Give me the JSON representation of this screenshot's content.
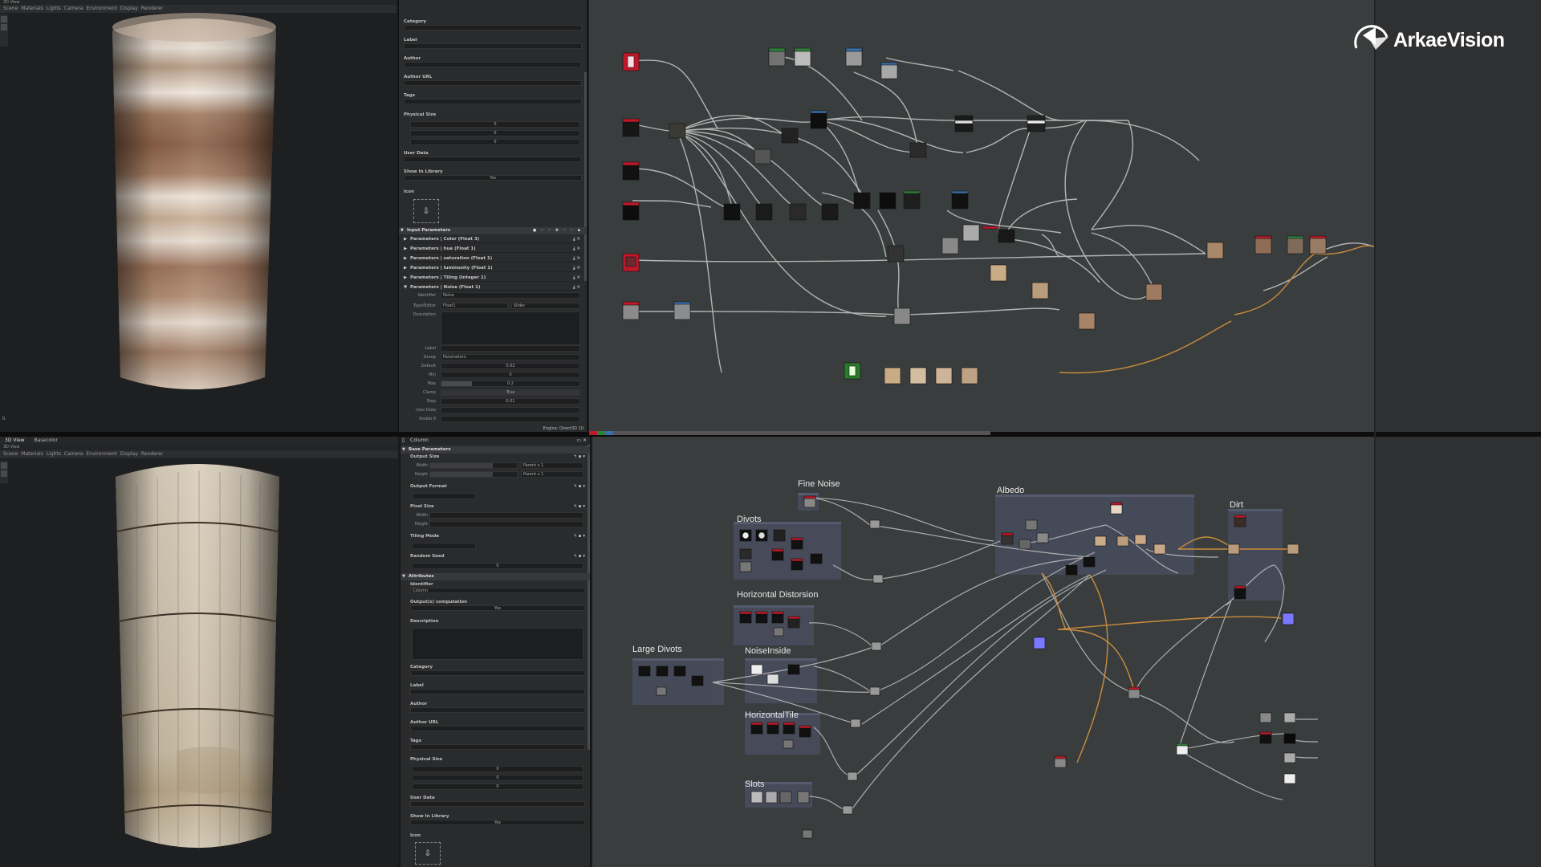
{
  "brand": {
    "name": "ArkaeVision"
  },
  "top_viewport": {
    "title": "3D View",
    "menu": [
      "Scene",
      "Materials",
      "Lights",
      "Camera",
      "Environment",
      "Display",
      "Renderer"
    ]
  },
  "bottom_viewport": {
    "tabs": [
      "3D View",
      "Basecolor"
    ],
    "title": "3D View",
    "menu": [
      "Scene",
      "Materials",
      "Lights",
      "Camera",
      "Environment",
      "Display",
      "Renderer"
    ]
  },
  "top_props": {
    "fields": [
      {
        "label": "Category",
        "value": ""
      },
      {
        "label": "Label",
        "value": ""
      },
      {
        "label": "Author",
        "value": ""
      },
      {
        "label": "Author URL",
        "value": ""
      },
      {
        "label": "Tags",
        "value": ""
      }
    ],
    "physical_size": {
      "label": "Physical Size",
      "x": "0",
      "y": "0",
      "z": "0"
    },
    "user_data": "User Data",
    "show_in_library": {
      "label": "Show In Library",
      "value": "Yes"
    },
    "icon_label": "Icon",
    "input_parameters": {
      "header": "Input Parameters",
      "items": [
        "Parameters | Color (Float 3)",
        "Parameters | hue (Float 1)",
        "Parameters | saturation (Float 1)",
        "Parameters | luminosity (Float 1)",
        "Parameters | Tiling (Integer 1)",
        "Parameters | Noise (Float 1)"
      ]
    },
    "noise_param": {
      "identifier": {
        "label": "Identifier",
        "value": "Noise"
      },
      "type_editor": {
        "label": "Type/Editor",
        "type": "Float1",
        "editor": "Slider"
      },
      "description": {
        "label": "Description"
      },
      "label": {
        "label": "Label",
        "value": ""
      },
      "group": {
        "label": "Group",
        "value": "Parameters"
      },
      "default": {
        "label": "Default",
        "value": "0.02"
      },
      "min": {
        "label": "Min",
        "value": "0"
      },
      "max": {
        "label": "Max",
        "value": "0.2"
      },
      "clamp": {
        "label": "Clamp",
        "value": "True"
      },
      "step": {
        "label": "Step",
        "value": "0.01"
      },
      "user_data": {
        "label": "User Data"
      },
      "visible_if": {
        "label": "Visible If"
      }
    },
    "engine": "Engine: Direct3D 10"
  },
  "bottom_props": {
    "title": "Column",
    "base_parameters": "Base Parameters",
    "output_size": {
      "label": "Output Size",
      "width": "Width",
      "height": "Height",
      "width_val": "Parent x 1",
      "height_val": "Parent x 1"
    },
    "output_format": "Output Format",
    "pixel_size": {
      "label": "Pixel Size",
      "width": "Width",
      "height": "Height"
    },
    "tiling_mode": "Tiling Mode",
    "random_seed": {
      "label": "Random Seed",
      "value": "0"
    },
    "attributes": "Attributes",
    "identifier": {
      "label": "Identifier",
      "value": "Column"
    },
    "output_computation": {
      "label": "Output(s) computation",
      "value": "Yes"
    },
    "fields": [
      "Description",
      "Category",
      "Label",
      "Author",
      "Author URL",
      "Tags"
    ],
    "physical_size": {
      "label": "Physical Size",
      "x": "0",
      "y": "0",
      "z": "0"
    },
    "user_data": "User Data",
    "show_in_library": {
      "label": "Show In Library",
      "value": "Yes"
    },
    "icon_label": "Icon"
  },
  "bottom_graph": {
    "frames": [
      {
        "id": "fine-noise",
        "label": "Fine Noise"
      },
      {
        "id": "divots",
        "label": "Divots"
      },
      {
        "id": "horizontal-distorsion",
        "label": "Horizontal Distorsion"
      },
      {
        "id": "large-divots",
        "label": "Large Divots"
      },
      {
        "id": "noise-inside",
        "label": "NoiseInside"
      },
      {
        "id": "horizontal-tile",
        "label": "HorizontalTile"
      },
      {
        "id": "slots",
        "label": "Slots"
      },
      {
        "id": "albedo",
        "label": "Albedo"
      },
      {
        "id": "dirt",
        "label": "Dirt"
      }
    ]
  },
  "colors": {
    "graph_bg": "#3a3d3e",
    "node_header_red": "#c0182a",
    "wire_orange": "#c98d3b",
    "accent_blue": "#7b78ff"
  }
}
